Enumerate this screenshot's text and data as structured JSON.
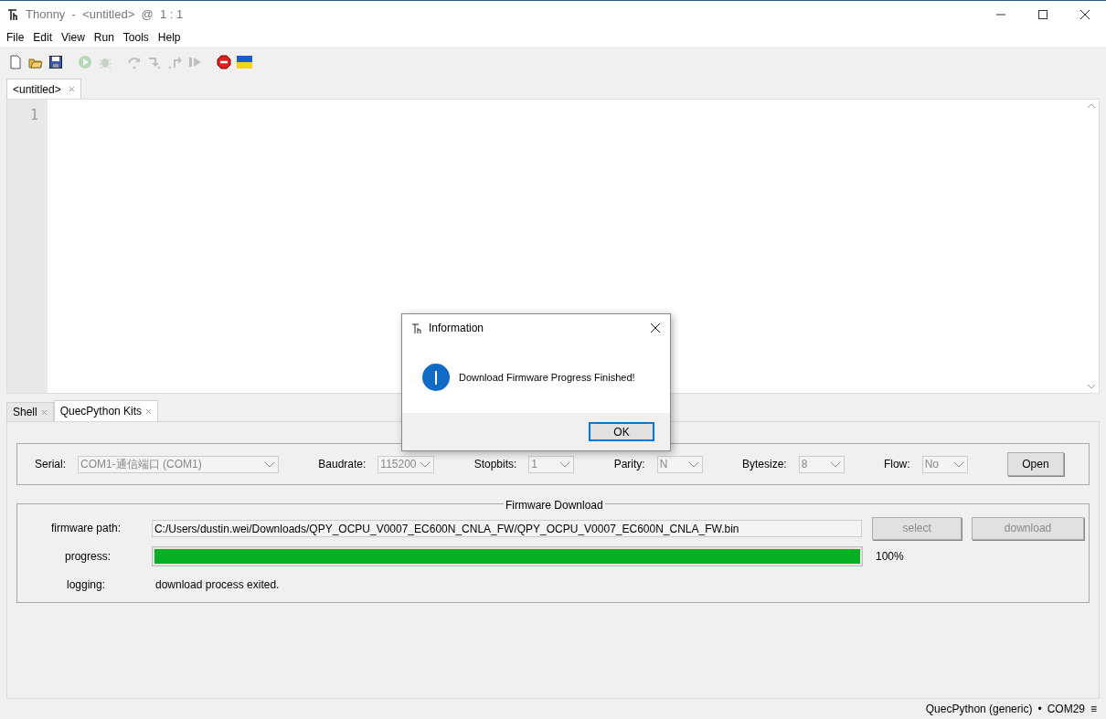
{
  "window": {
    "title": "Thonny  -  <untitled>  @  1 : 1"
  },
  "menu": [
    "File",
    "Edit",
    "View",
    "Run",
    "Tools",
    "Help"
  ],
  "toolbar": [
    {
      "kind": "new",
      "disabled": false
    },
    {
      "kind": "open",
      "disabled": false
    },
    {
      "kind": "save",
      "disabled": false
    },
    {
      "kind": "run",
      "disabled": true
    },
    {
      "kind": "debug",
      "disabled": true
    },
    {
      "kind": "step_over",
      "disabled": true
    },
    {
      "kind": "step_into",
      "disabled": true
    },
    {
      "kind": "step_out",
      "disabled": true
    },
    {
      "kind": "resume",
      "disabled": true
    },
    {
      "kind": "stop",
      "disabled": false
    },
    {
      "kind": "flag",
      "disabled": false
    }
  ],
  "editor_tabs": [
    {
      "label": "<untitled>",
      "selected": true
    }
  ],
  "editor": {
    "line_numbers": [
      "1"
    ]
  },
  "bottom_tabs": [
    {
      "label": "Shell",
      "selected": false
    },
    {
      "label": "QuecPython Kits",
      "selected": true
    }
  ],
  "serial_settings": {
    "fields": [
      {
        "label": "Serial:",
        "value": "COM1-通信端口 (COM1)",
        "disabled": true
      },
      {
        "label": "Baudrate:",
        "value": "115200",
        "disabled": true
      },
      {
        "label": "Stopbits:",
        "value": "1",
        "disabled": true
      },
      {
        "label": "Parity:",
        "value": "N",
        "disabled": true
      },
      {
        "label": "Bytesize:",
        "value": "8",
        "disabled": true
      },
      {
        "label": "Flow:",
        "value": "No",
        "disabled": true
      }
    ],
    "open_button": "Open"
  },
  "firmware_download": {
    "title": "Firmware Download",
    "path_label": "firmware path:",
    "path": "C:/Users/dustin.wei/Downloads/QPY_OCPU_V0007_EC600N_CNLA_FW/QPY_OCPU_V0007_EC600N_CNLA_FW.bin",
    "select_button": {
      "label": "select",
      "disabled": true
    },
    "download_button": {
      "label": "download",
      "disabled": true
    },
    "progress_label": "progress:",
    "progress": {
      "level": 1
    },
    "percent": "100%",
    "logging_label": "logging:",
    "logging": "download process exited."
  },
  "status_bar": {
    "interpreter": "QuecPython (generic)",
    "separator": "•",
    "port": "COM29",
    "menu": "≡"
  },
  "dialog": {
    "title": "Information",
    "message": "Download Firmware Progress Finished!",
    "ok_button": "OK"
  }
}
